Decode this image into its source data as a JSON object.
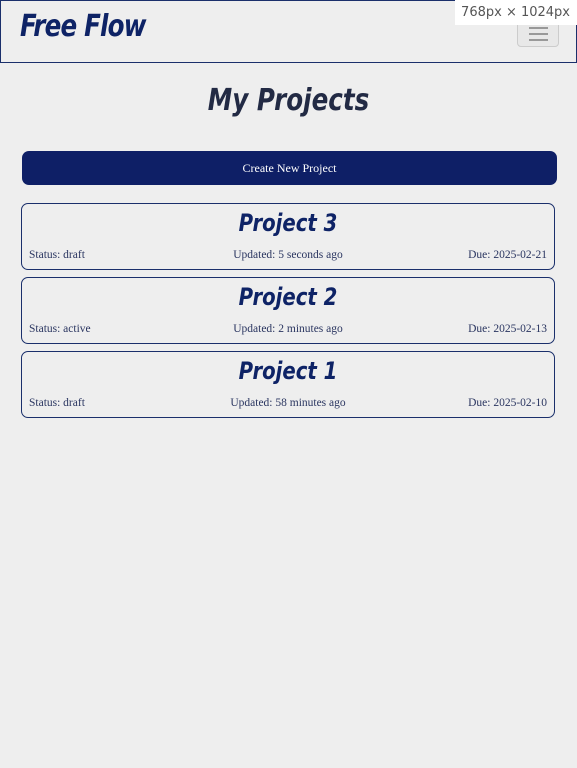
{
  "app": {
    "brand": "Free Flow",
    "viewport_badge": "768px × 1024px"
  },
  "header": {
    "menu_toggle_icon": "hamburger-icon"
  },
  "main": {
    "title": "My Projects",
    "create_button_label": "Create New Project",
    "projects": [
      {
        "title": "Project 3",
        "status": "Status: draft",
        "updated": "Updated: 5 seconds ago",
        "due": "Due: 2025-02-21"
      },
      {
        "title": "Project 2",
        "status": "Status: active",
        "updated": "Updated: 2 minutes ago",
        "due": "Due: 2025-02-13"
      },
      {
        "title": "Project 1",
        "status": "Status: draft",
        "updated": "Updated: 58 minutes ago",
        "due": "Due: 2025-02-10"
      }
    ]
  },
  "colors": {
    "brand": "#0e2366",
    "button_bg": "#0e1f66",
    "page_bg": "#eeeeee",
    "border": "#1a2f6b"
  }
}
